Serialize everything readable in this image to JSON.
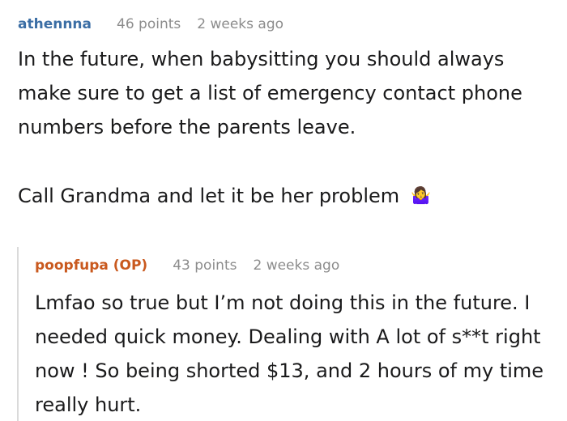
{
  "comment": {
    "username": "athennna",
    "points": "46 points",
    "time": "2 weeks ago",
    "paragraph_1": "In the future, when babysitting you should always make sure to get a list of emergency contact phone numbers before the parents leave.",
    "paragraph_2": "Call Grandma and let it be her problem",
    "emoji": "🤷‍♀️"
  },
  "reply": {
    "username": "poopfupa (OP)",
    "points": "43 points",
    "time": "2 weeks ago",
    "text": "Lmfao so true but I’m not doing this in the future. I needed quick money. Dealing with A lot of s**t right now ! So being shorted $13, and 2 hours of my time really hurt."
  },
  "colors": {
    "username_link": "#3b6ea5",
    "op_username": "#c9591e",
    "meta_text": "#8c8c8c",
    "body_text": "#1a1a1b",
    "thread_line": "#dadada"
  }
}
